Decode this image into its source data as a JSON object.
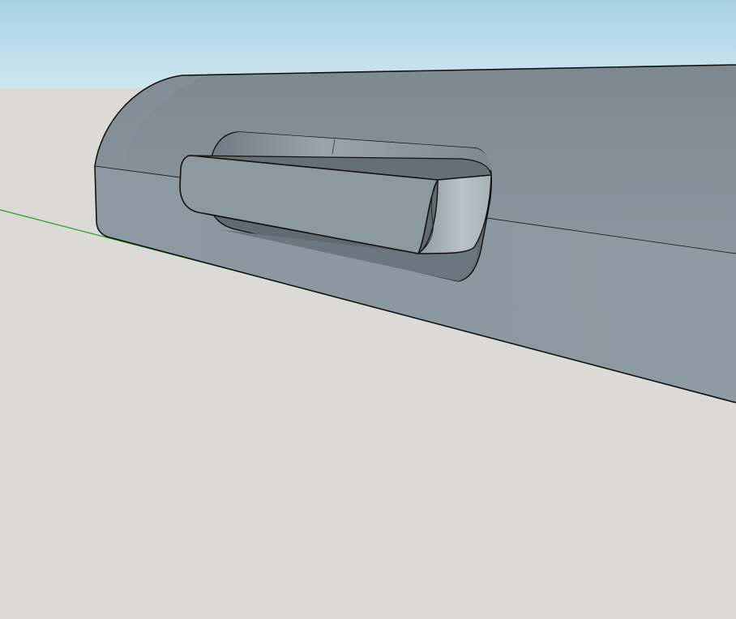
{
  "scene": {
    "colors": {
      "sky_top": "#a7d2e4",
      "sky_bottom": "#cfe6ef",
      "ground": "#dbdad6",
      "model_face": "#8a979f",
      "model_face_light": "#97a3aa",
      "model_top": "#7f8a91",
      "recess_dark": "#5f6a71",
      "recess_mid": "#727e85",
      "handle_face": "#8c999f",
      "handle_end_light": "#b7c0c5",
      "edge": "#111111",
      "axis_green": "#1fa51f"
    }
  }
}
